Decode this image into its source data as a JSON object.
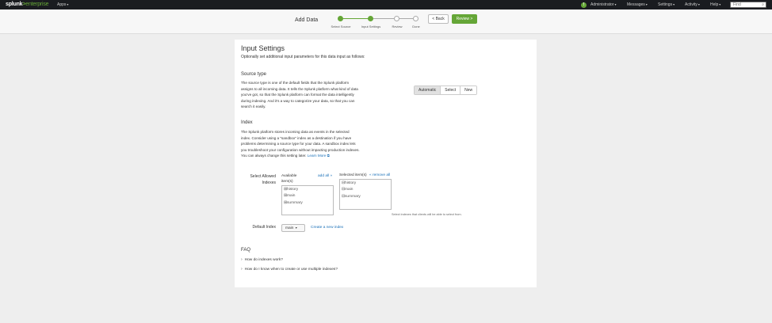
{
  "topnav": {
    "logo_main": "splunk",
    "logo_gt": ">",
    "logo_suffix": "enterprise",
    "apps": "Apps",
    "status_badge": "!",
    "user": "Administrator",
    "messages": "Messages",
    "settings": "Settings",
    "activity": "Activity",
    "help": "Help",
    "find_placeholder": "Find"
  },
  "wizard": {
    "title": "Add Data",
    "steps": [
      {
        "label": "Select Source",
        "state": "done"
      },
      {
        "label": "Input Settings",
        "state": "done"
      },
      {
        "label": "Review",
        "state": "todo"
      },
      {
        "label": "Done",
        "state": "todo"
      }
    ],
    "back_label": "< Back",
    "review_label": "Review >"
  },
  "panel": {
    "title": "Input Settings",
    "subtitle": "Optionally set additional input parameters for this data input as follows:",
    "source_type": {
      "heading": "Source type",
      "description": "The source type is one of the default fields that the Splunk platform assigns to all incoming data. It tells the Splunk platform what kind of data you've got, so that the Splunk platform can format the data intelligently during indexing. And it's a way to categorize your data, so that you can search it easily.",
      "options": [
        "Automatic",
        "Select",
        "New"
      ],
      "selected": "Automatic"
    },
    "index": {
      "heading": "Index",
      "description": "The Splunk platform stores incoming data as events in the selected index. Consider using a \"sandbox\" index as a destination if you have problems determining a source type for your data. A sandbox index lets you troubleshoot your configuration without impacting production indexes. You can always change this setting later.",
      "learn_more": "Learn More",
      "select_label": "Select Allowed Indexes",
      "available_label": "Available item(s)",
      "add_all": "add all »",
      "selected_label": "Selected item(s)",
      "remove_all": "« remove all",
      "available_items": [
        "history",
        "main",
        "summary"
      ],
      "selected_items": [
        "history",
        "main",
        "summary"
      ],
      "help_text": "Select indexes that clients will be able to select from.",
      "default_label": "Default Index",
      "default_value": "main",
      "create_link": "Create a new index"
    },
    "faq": {
      "heading": "FAQ",
      "items": [
        "How do indexes work?",
        "How do I know when to create or use multiple indexes?"
      ]
    }
  },
  "colors": {
    "accent": "#65a637",
    "nav_bg": "#1a1c20",
    "link": "#1a70b8",
    "page_bg": "#eeeeee"
  }
}
